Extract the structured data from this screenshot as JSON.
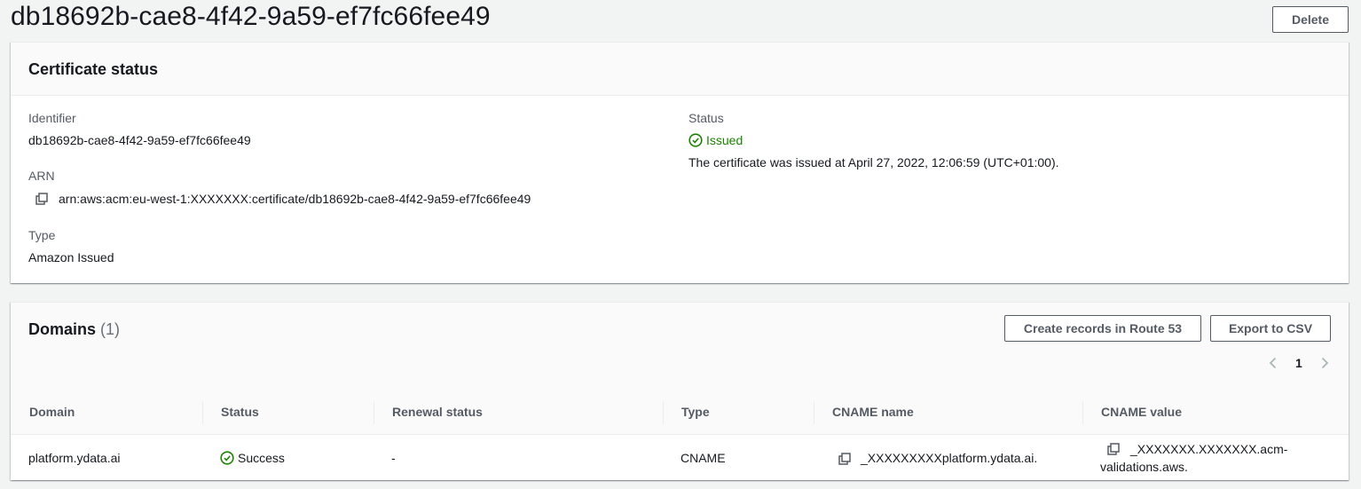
{
  "header": {
    "title": "db18692b-cae8-4f42-9a59-ef7fc66fee49",
    "delete_label": "Delete"
  },
  "certificate_status": {
    "heading": "Certificate status",
    "identifier_label": "Identifier",
    "identifier_value": "db18692b-cae8-4f42-9a59-ef7fc66fee49",
    "arn_label": "ARN",
    "arn_value": "arn:aws:acm:eu-west-1:XXXXXXX:certificate/db18692b-cae8-4f42-9a59-ef7fc66fee49",
    "type_label": "Type",
    "type_value": "Amazon Issued",
    "status_label": "Status",
    "status_value": "Issued",
    "status_detail": "The certificate was issued at April 27, 2022, 12:06:59 (UTC+01:00)."
  },
  "domains": {
    "heading": "Domains",
    "count": "(1)",
    "create_records_label": "Create records in Route 53",
    "export_label": "Export to CSV",
    "page_number": "1",
    "columns": [
      "Domain",
      "Status",
      "Renewal status",
      "Type",
      "CNAME name",
      "CNAME value"
    ],
    "rows": [
      {
        "domain": "platform.ydata.ai",
        "status": "Success",
        "renewal_status": "-",
        "type": "CNAME",
        "cname_name": "_XXXXXXXXXplatform.ydata.ai.",
        "cname_value_line1": "_XXXXXXX.XXXXXXX.acm-",
        "cname_value_line2": "validations.aws."
      }
    ]
  },
  "colors": {
    "success": "#1d8102",
    "text": "#16191f",
    "label": "#545b64",
    "background": "#f2f3f3"
  },
  "icons": [
    "copy-icon",
    "status-success-icon",
    "chevron-left-icon",
    "chevron-right-icon"
  ]
}
